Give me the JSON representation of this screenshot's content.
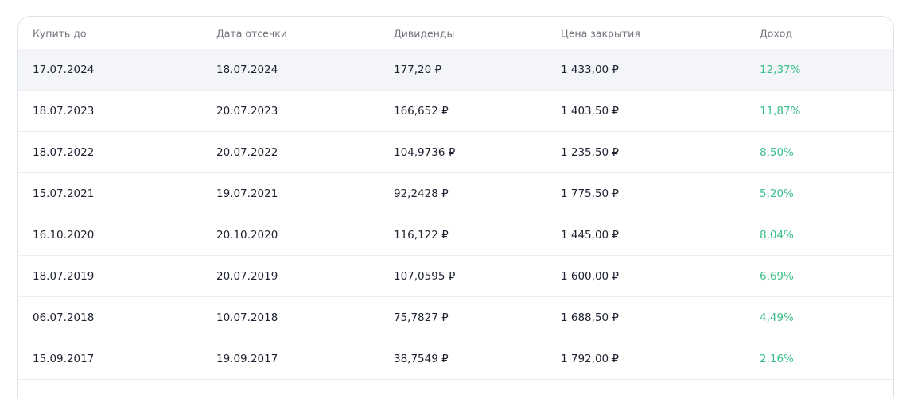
{
  "table": {
    "headers": [
      "Купить до",
      "Дата отсечки",
      "Дивиденды",
      "Цена закрытия",
      "Доход"
    ],
    "accent_color": "#3bbf8a",
    "rows": [
      [
        "17.07.2024",
        "18.07.2024",
        "177,20 ₽",
        "1 433,00 ₽",
        "12,37%"
      ],
      [
        "18.07.2023",
        "20.07.2023",
        "166,652 ₽",
        "1 403,50 ₽",
        "11,87%"
      ],
      [
        "18.07.2022",
        "20.07.2022",
        "104,9736 ₽",
        "1 235,50 ₽",
        "8,50%"
      ],
      [
        "15.07.2021",
        "19.07.2021",
        "92,2428 ₽",
        "1 775,50 ₽",
        "5,20%"
      ],
      [
        "16.10.2020",
        "20.10.2020",
        "116,122 ₽",
        "1 445,00 ₽",
        "8,04%"
      ],
      [
        "18.07.2019",
        "20.07.2019",
        "107,0595 ₽",
        "1 600,00 ₽",
        "6,69%"
      ],
      [
        "06.07.2018",
        "10.07.2018",
        "75,7827 ₽",
        "1 688,50 ₽",
        "4,49%"
      ],
      [
        "15.09.2017",
        "19.09.2017",
        "38,7549 ₽",
        "1 792,00 ₽",
        "2,16%"
      ]
    ]
  }
}
